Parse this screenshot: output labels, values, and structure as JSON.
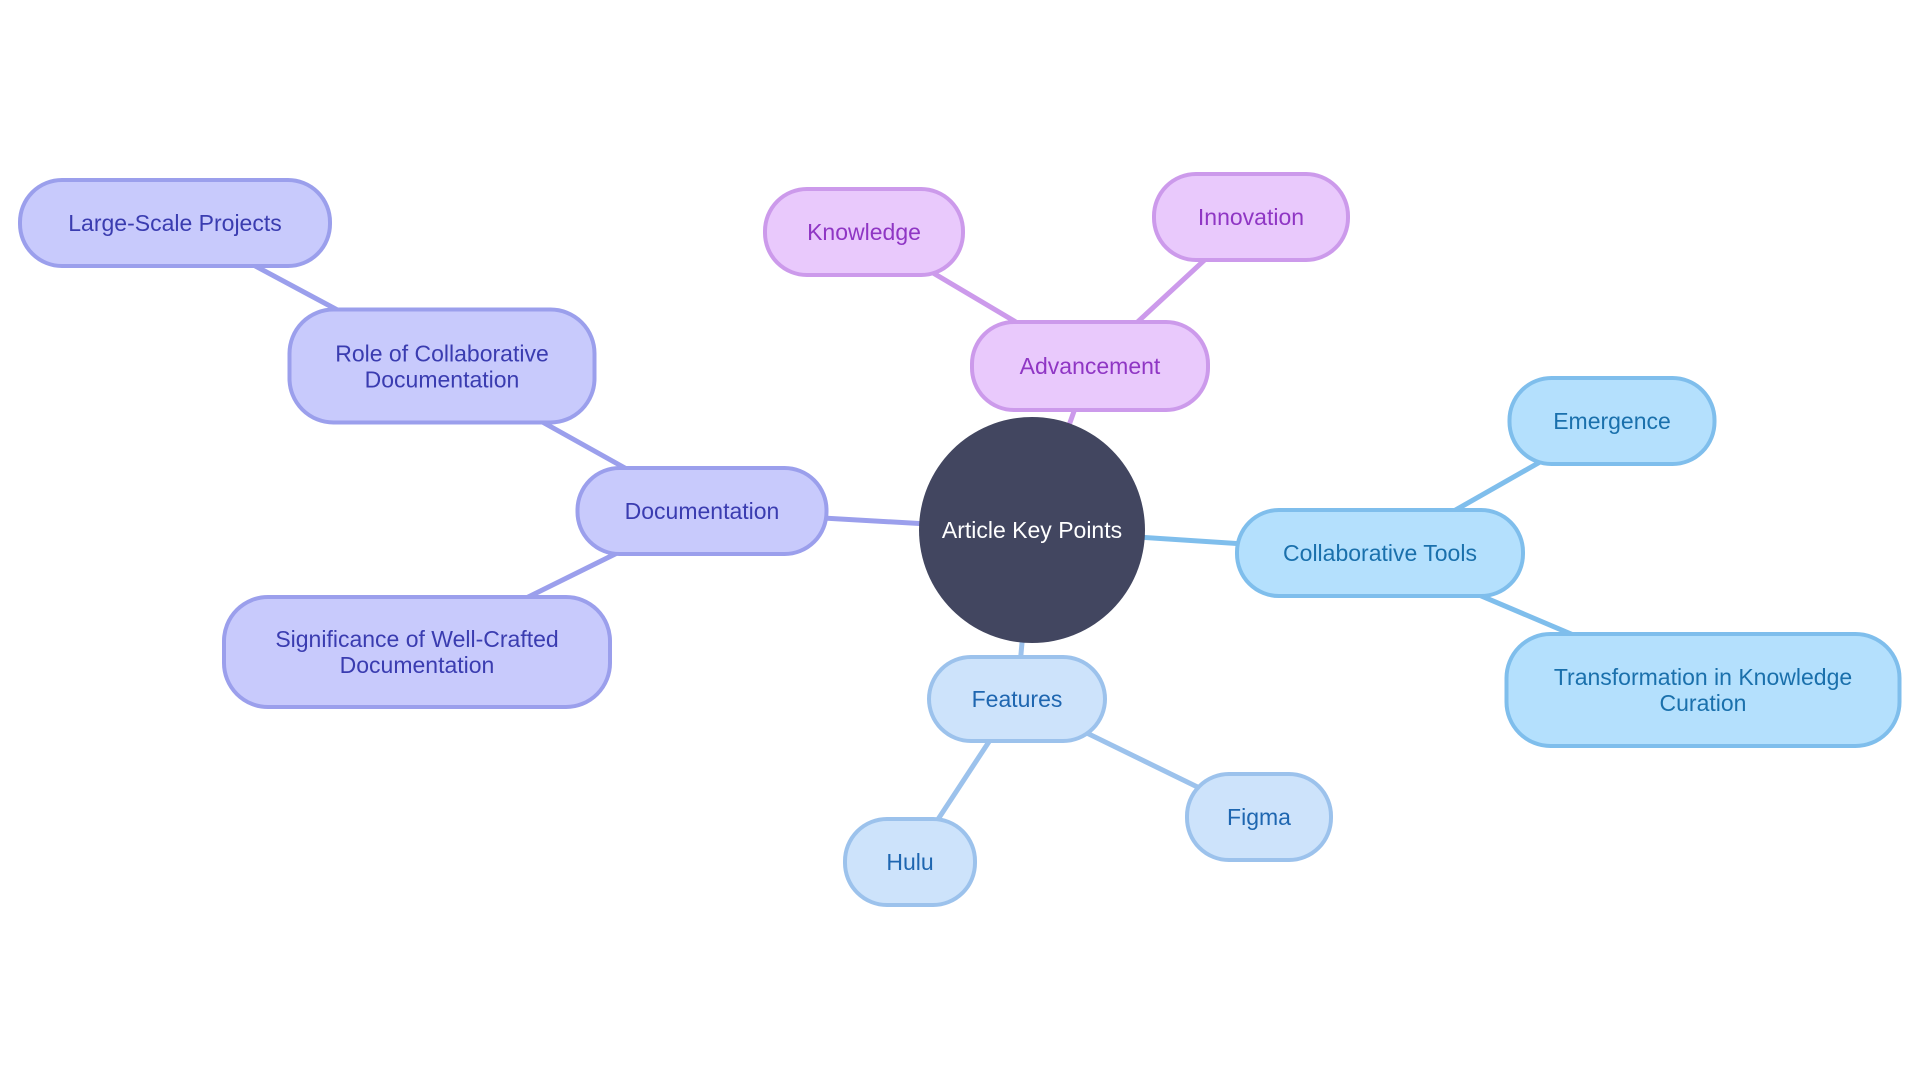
{
  "diagram": {
    "type": "mindmap",
    "root": {
      "id": "root",
      "label": "Article Key Points"
    },
    "colors": {
      "root_fill": "#424660",
      "root_text": "#ffffff",
      "documentation": {
        "fill": "#c8cafc",
        "stroke": "#9b9fec",
        "text": "#3a3cb0"
      },
      "advancement": {
        "fill": "#e9c9fc",
        "stroke": "#cc9aeb",
        "text": "#8f36c4"
      },
      "collaborative_tools": {
        "fill": "#b4e0fd",
        "stroke": "#7fbeec",
        "text": "#1a70ac"
      },
      "features": {
        "fill": "#cde3fb",
        "stroke": "#9cc2ec",
        "text": "#1e66b0"
      }
    },
    "branches": [
      {
        "id": "documentation",
        "label": "Documentation",
        "children": [
          {
            "id": "role",
            "label": "Role of Collaborative Documentation",
            "children": [
              {
                "id": "large-scale",
                "label": "Large-Scale Projects"
              }
            ]
          },
          {
            "id": "significance",
            "label": "Significance of Well-Crafted Documentation"
          }
        ]
      },
      {
        "id": "advancement",
        "label": "Advancement",
        "children": [
          {
            "id": "knowledge",
            "label": "Knowledge"
          },
          {
            "id": "innovation",
            "label": "Innovation"
          }
        ]
      },
      {
        "id": "collaborative-tools",
        "label": "Collaborative Tools",
        "children": [
          {
            "id": "emergence",
            "label": "Emergence"
          },
          {
            "id": "transformation",
            "label": "Transformation in Knowledge Curation"
          }
        ]
      },
      {
        "id": "features",
        "label": "Features",
        "children": [
          {
            "id": "hulu",
            "label": "Hulu"
          },
          {
            "id": "figma",
            "label": "Figma"
          }
        ]
      }
    ],
    "edges": [
      [
        "root",
        "documentation"
      ],
      [
        "documentation",
        "role"
      ],
      [
        "role",
        "large-scale"
      ],
      [
        "documentation",
        "significance"
      ],
      [
        "root",
        "advancement"
      ],
      [
        "advancement",
        "knowledge"
      ],
      [
        "advancement",
        "innovation"
      ],
      [
        "root",
        "collaborative-tools"
      ],
      [
        "collaborative-tools",
        "emergence"
      ],
      [
        "collaborative-tools",
        "transformation"
      ],
      [
        "root",
        "features"
      ],
      [
        "features",
        "hulu"
      ],
      [
        "features",
        "figma"
      ]
    ]
  }
}
